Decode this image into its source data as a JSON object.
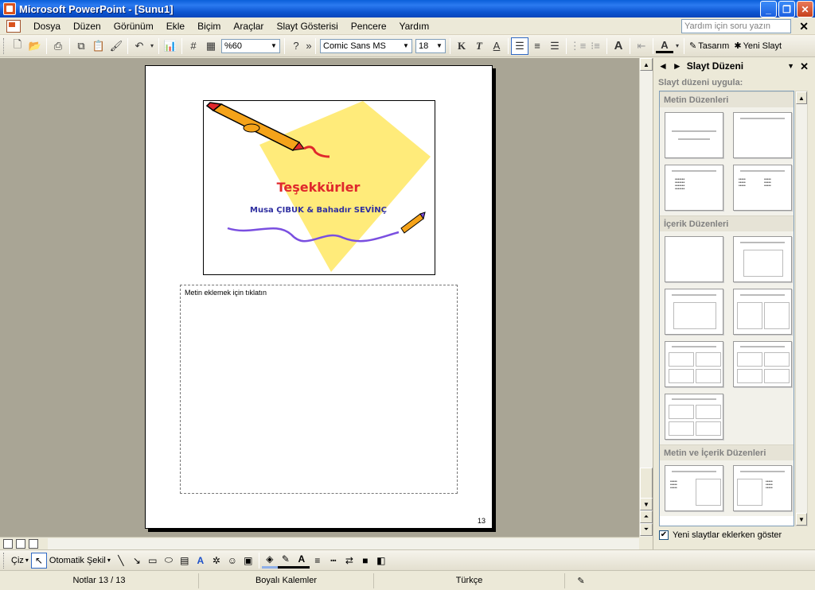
{
  "window": {
    "title": "Microsoft PowerPoint - [Sunu1]",
    "buttons": [
      "_",
      "❐",
      "✕"
    ]
  },
  "menu": {
    "items": [
      "Dosya",
      "Düzen",
      "Görünüm",
      "Ekle",
      "Biçim",
      "Araçlar",
      "Slayt Gösterisi",
      "Pencere",
      "Yardım"
    ],
    "help_placeholder": "Yardım için soru yazın",
    "close": "✕"
  },
  "toolbar": {
    "zoom": "%60",
    "font": "Comic Sans MS",
    "font_size": "18",
    "bold": "K",
    "italic": "T",
    "underline": "A",
    "design_label": "Tasarım",
    "new_slide_label": "Yeni Slayt",
    "font_color": "A"
  },
  "slide": {
    "title": "Teşekkürler",
    "subtitle": "Musa ÇIBUK & Bahadır SEVİNÇ",
    "title_color": "#E0282C",
    "subtitle_color": "#2F2FA0",
    "shape_color": "#FFEB7A"
  },
  "notes": {
    "placeholder": "Metin eklemek için tıklatın",
    "page_number": "13"
  },
  "taskpane": {
    "title": "Slayt Düzeni",
    "subtitle": "Slayt düzeni uygula:",
    "sections": [
      "Metin Düzenleri",
      "İçerik Düzenleri",
      "Metin ve İçerik Düzenleri"
    ],
    "show_checkbox": "Yeni slaytlar eklerken göster",
    "show_checked": true
  },
  "drawbar": {
    "draw_label": "Çiz",
    "autoshapes_label": "Otomatik Şekil"
  },
  "status": {
    "notes_page": "Notlar 13 / 13",
    "template": "Boyalı Kalemler",
    "language": "Türkçe"
  }
}
